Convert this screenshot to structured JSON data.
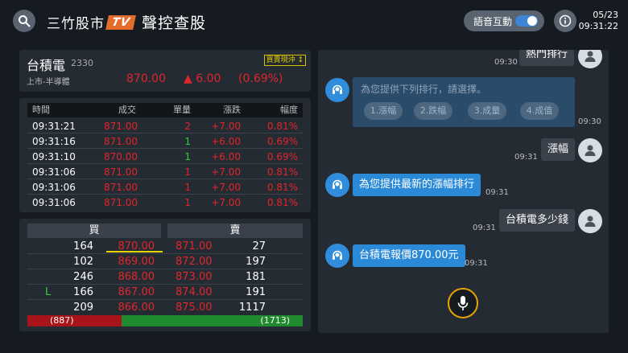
{
  "header": {
    "brand": "三竹股市",
    "brand_badge": "TV",
    "title": "聲控查股",
    "voice_label": "語音互動",
    "date": "05/23",
    "time": "09:31:22"
  },
  "quote": {
    "name": "台積電",
    "code": "2330",
    "sector": "上市-半導體",
    "mode": "買賣現沖",
    "price": "870.00",
    "arrow": "▲",
    "change": "6.00",
    "change_pct": "(0.69%)"
  },
  "ticks": {
    "headers": [
      "時間",
      "成交",
      "單量",
      "漲跌",
      "幅度"
    ],
    "rows": [
      {
        "time": "09:31:21",
        "price": "871.00",
        "vol": "2",
        "chg": "+7.00",
        "pct": "0.81%"
      },
      {
        "time": "09:31:16",
        "price": "871.00",
        "vol": "1",
        "chg": "+6.00",
        "pct": "0.69%"
      },
      {
        "time": "09:31:10",
        "price": "870.00",
        "vol": "1",
        "chg": "+6.00",
        "pct": "0.69%"
      },
      {
        "time": "09:31:06",
        "price": "871.00",
        "vol": "1",
        "chg": "+7.00",
        "pct": "0.81%"
      },
      {
        "time": "09:31:06",
        "price": "871.00",
        "vol": "1",
        "chg": "+7.00",
        "pct": "0.81%"
      },
      {
        "time": "09:31:06",
        "price": "871.00",
        "vol": "1",
        "chg": "+7.00",
        "pct": "0.81%"
      }
    ]
  },
  "book": {
    "buy_label": "買",
    "sell_label": "賣",
    "rows": [
      {
        "flag": "",
        "bid_vol": "164",
        "bid": "870.00",
        "ask": "871.00",
        "ask_vol": "27"
      },
      {
        "flag": "",
        "bid_vol": "102",
        "bid": "869.00",
        "ask": "872.00",
        "ask_vol": "197"
      },
      {
        "flag": "",
        "bid_vol": "246",
        "bid": "868.00",
        "ask": "873.00",
        "ask_vol": "181"
      },
      {
        "flag": "L",
        "bid_vol": "166",
        "bid": "867.00",
        "ask": "874.00",
        "ask_vol": "191"
      },
      {
        "flag": "",
        "bid_vol": "209",
        "bid": "866.00",
        "ask": "875.00",
        "ask_vol": "1117"
      }
    ],
    "buy_total": "(887)",
    "sell_total": "(1713)",
    "buy_ratio": 0.341
  },
  "chat": {
    "m1": {
      "text": "熱門排行",
      "time": "09:30"
    },
    "options": {
      "prompt": "為您提供下列排行，請選擇。",
      "items": [
        "1.漲幅",
        "2.跌幅",
        "3.成量",
        "4.成值"
      ],
      "time": "09:30"
    },
    "m2": {
      "text": "漲幅",
      "time": "09:31"
    },
    "m3": {
      "text": "為您提供最新的漲幅排行",
      "time": "09:31"
    },
    "m4": {
      "text": "台積電多少錢",
      "time": "09:31"
    },
    "m5": {
      "text": "台積電報價870.00元",
      "time": "09:31"
    }
  },
  "colors": {
    "up": "#e0262a",
    "down": "#2fd13a",
    "accent": "#2a8ad8",
    "mic": "#e6a600"
  }
}
